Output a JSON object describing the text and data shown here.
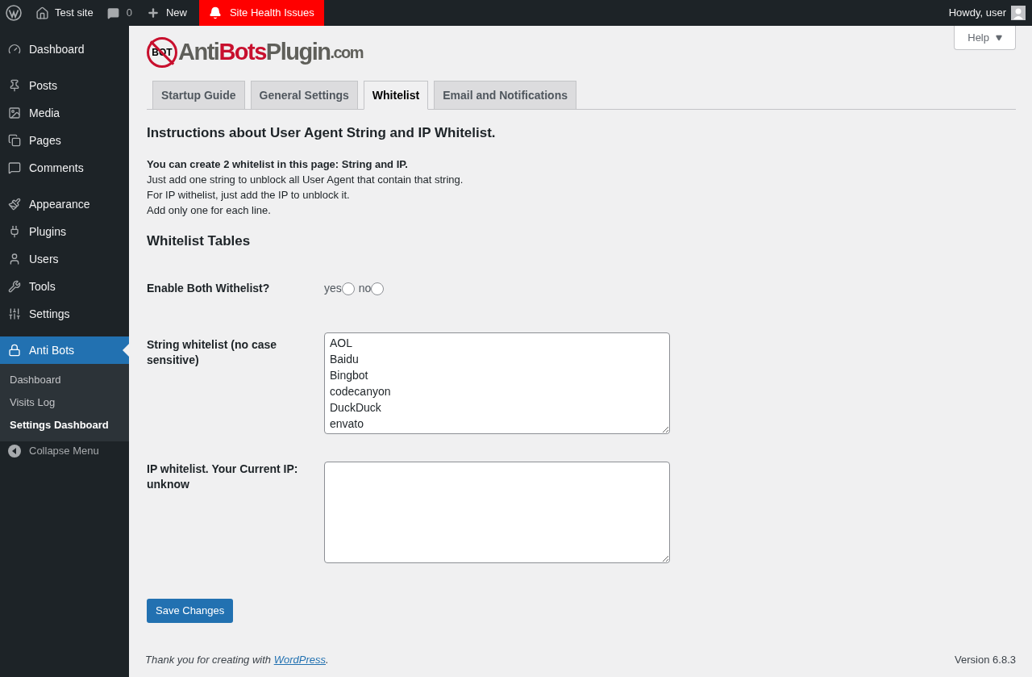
{
  "admin_bar": {
    "site": "Test site",
    "comments": "0",
    "new": "New",
    "alert": "Site Health Issues",
    "greeting": "Howdy, user"
  },
  "sidebar": {
    "groups": [
      [
        {
          "label": "Dashboard",
          "selected": false
        }
      ],
      [
        {
          "label": "Posts",
          "selected": false
        },
        {
          "label": "Media",
          "selected": false
        },
        {
          "label": "Pages",
          "selected": false
        },
        {
          "label": "Comments",
          "selected": false
        }
      ],
      [
        {
          "label": "Appearance",
          "selected": false
        },
        {
          "label": "Plugins",
          "selected": false
        },
        {
          "label": "Users",
          "selected": false
        },
        {
          "label": "Tools",
          "selected": false
        },
        {
          "label": "Settings",
          "selected": false
        }
      ],
      [
        {
          "label": "Anti Bots",
          "selected": true,
          "children": [
            {
              "label": "Dashboard",
              "selected": false
            },
            {
              "label": "Visits Log",
              "selected": false
            },
            {
              "label": "Settings Dashboard",
              "selected": true
            }
          ]
        }
      ]
    ],
    "collapse": "Collapse Menu"
  },
  "help": "Help",
  "logo": {
    "badge": "BOT",
    "parts": [
      {
        "text": "Anti",
        "kind": "plain"
      },
      {
        "text": "Bots",
        "kind": "accent"
      },
      {
        "text": "Plugin",
        "kind": "plain"
      },
      {
        "text": ".com",
        "kind": "small"
      }
    ]
  },
  "tabs": [
    {
      "label": "Startup Guide",
      "selected": false
    },
    {
      "label": "General Settings",
      "selected": false
    },
    {
      "label": "Whitelist",
      "selected": true
    },
    {
      "label": "Email and Notifications",
      "selected": false
    }
  ],
  "heading": "Instructions about User Agent String and IP Whitelist.",
  "instructions": [
    {
      "text": "You can create 2 whitelist in this page: String and IP.",
      "kind": "bold"
    },
    {
      "text": "Just add one string to unblock all User Agent that contain that string.",
      "kind": "plain"
    },
    {
      "text": "For IP withelist, just add the IP to unblock it.",
      "kind": "plain"
    },
    {
      "text": "Add only one for each line.",
      "kind": "plain"
    }
  ],
  "section_title": "Whitelist Tables",
  "enable": {
    "label": "Enable Both Withelist?",
    "options": [
      {
        "label": "yes",
        "selected": false
      },
      {
        "label": "no",
        "selected": false
      }
    ]
  },
  "string_whitelist": {
    "label": "String whitelist (no case sensitive)",
    "lines": [
      "AOL",
      "Baidu",
      "Bingbot",
      "codecanyon",
      "DuckDuck",
      "envato"
    ]
  },
  "ip_whitelist": {
    "label": "IP whitelist. Your Current IP: unknow"
  },
  "save": "Save Changes",
  "footer": {
    "before": "Thank you for creating with ",
    "link": "WordPress",
    "after": ".",
    "version": "Version 6.8.3"
  }
}
